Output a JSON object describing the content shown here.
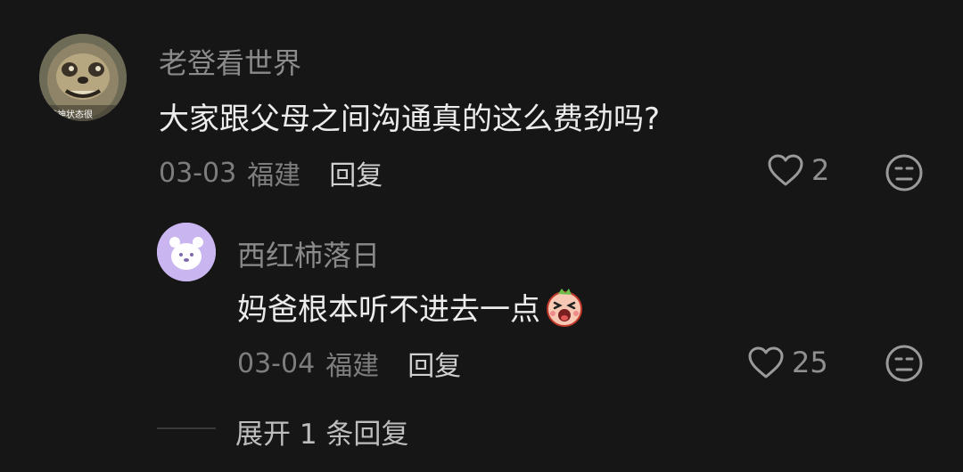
{
  "comments": [
    {
      "username": "老登看世界",
      "text": "大家跟父母之间沟通真的这么费劲吗?",
      "avatar_caption": "精神状态很",
      "date": "03-03",
      "location": "福建",
      "reply_label": "回复",
      "likes": "2"
    }
  ],
  "replies": [
    {
      "username": "西红柿落日",
      "text": "妈爸根本听不进去一点",
      "emoji": "screaming-face-emoji",
      "date": "03-04",
      "location": "福建",
      "reply_label": "回复",
      "likes": "25"
    }
  ],
  "expand_label": "展开 1 条回复",
  "colors": {
    "background": "#161616",
    "username": "#8a8a8a",
    "text": "#ececec",
    "meta": "#7d7d7d",
    "reply_avatar_bg": "#c9b6f0"
  },
  "icons": [
    "heart-outline-icon",
    "neutral-face-icon"
  ]
}
